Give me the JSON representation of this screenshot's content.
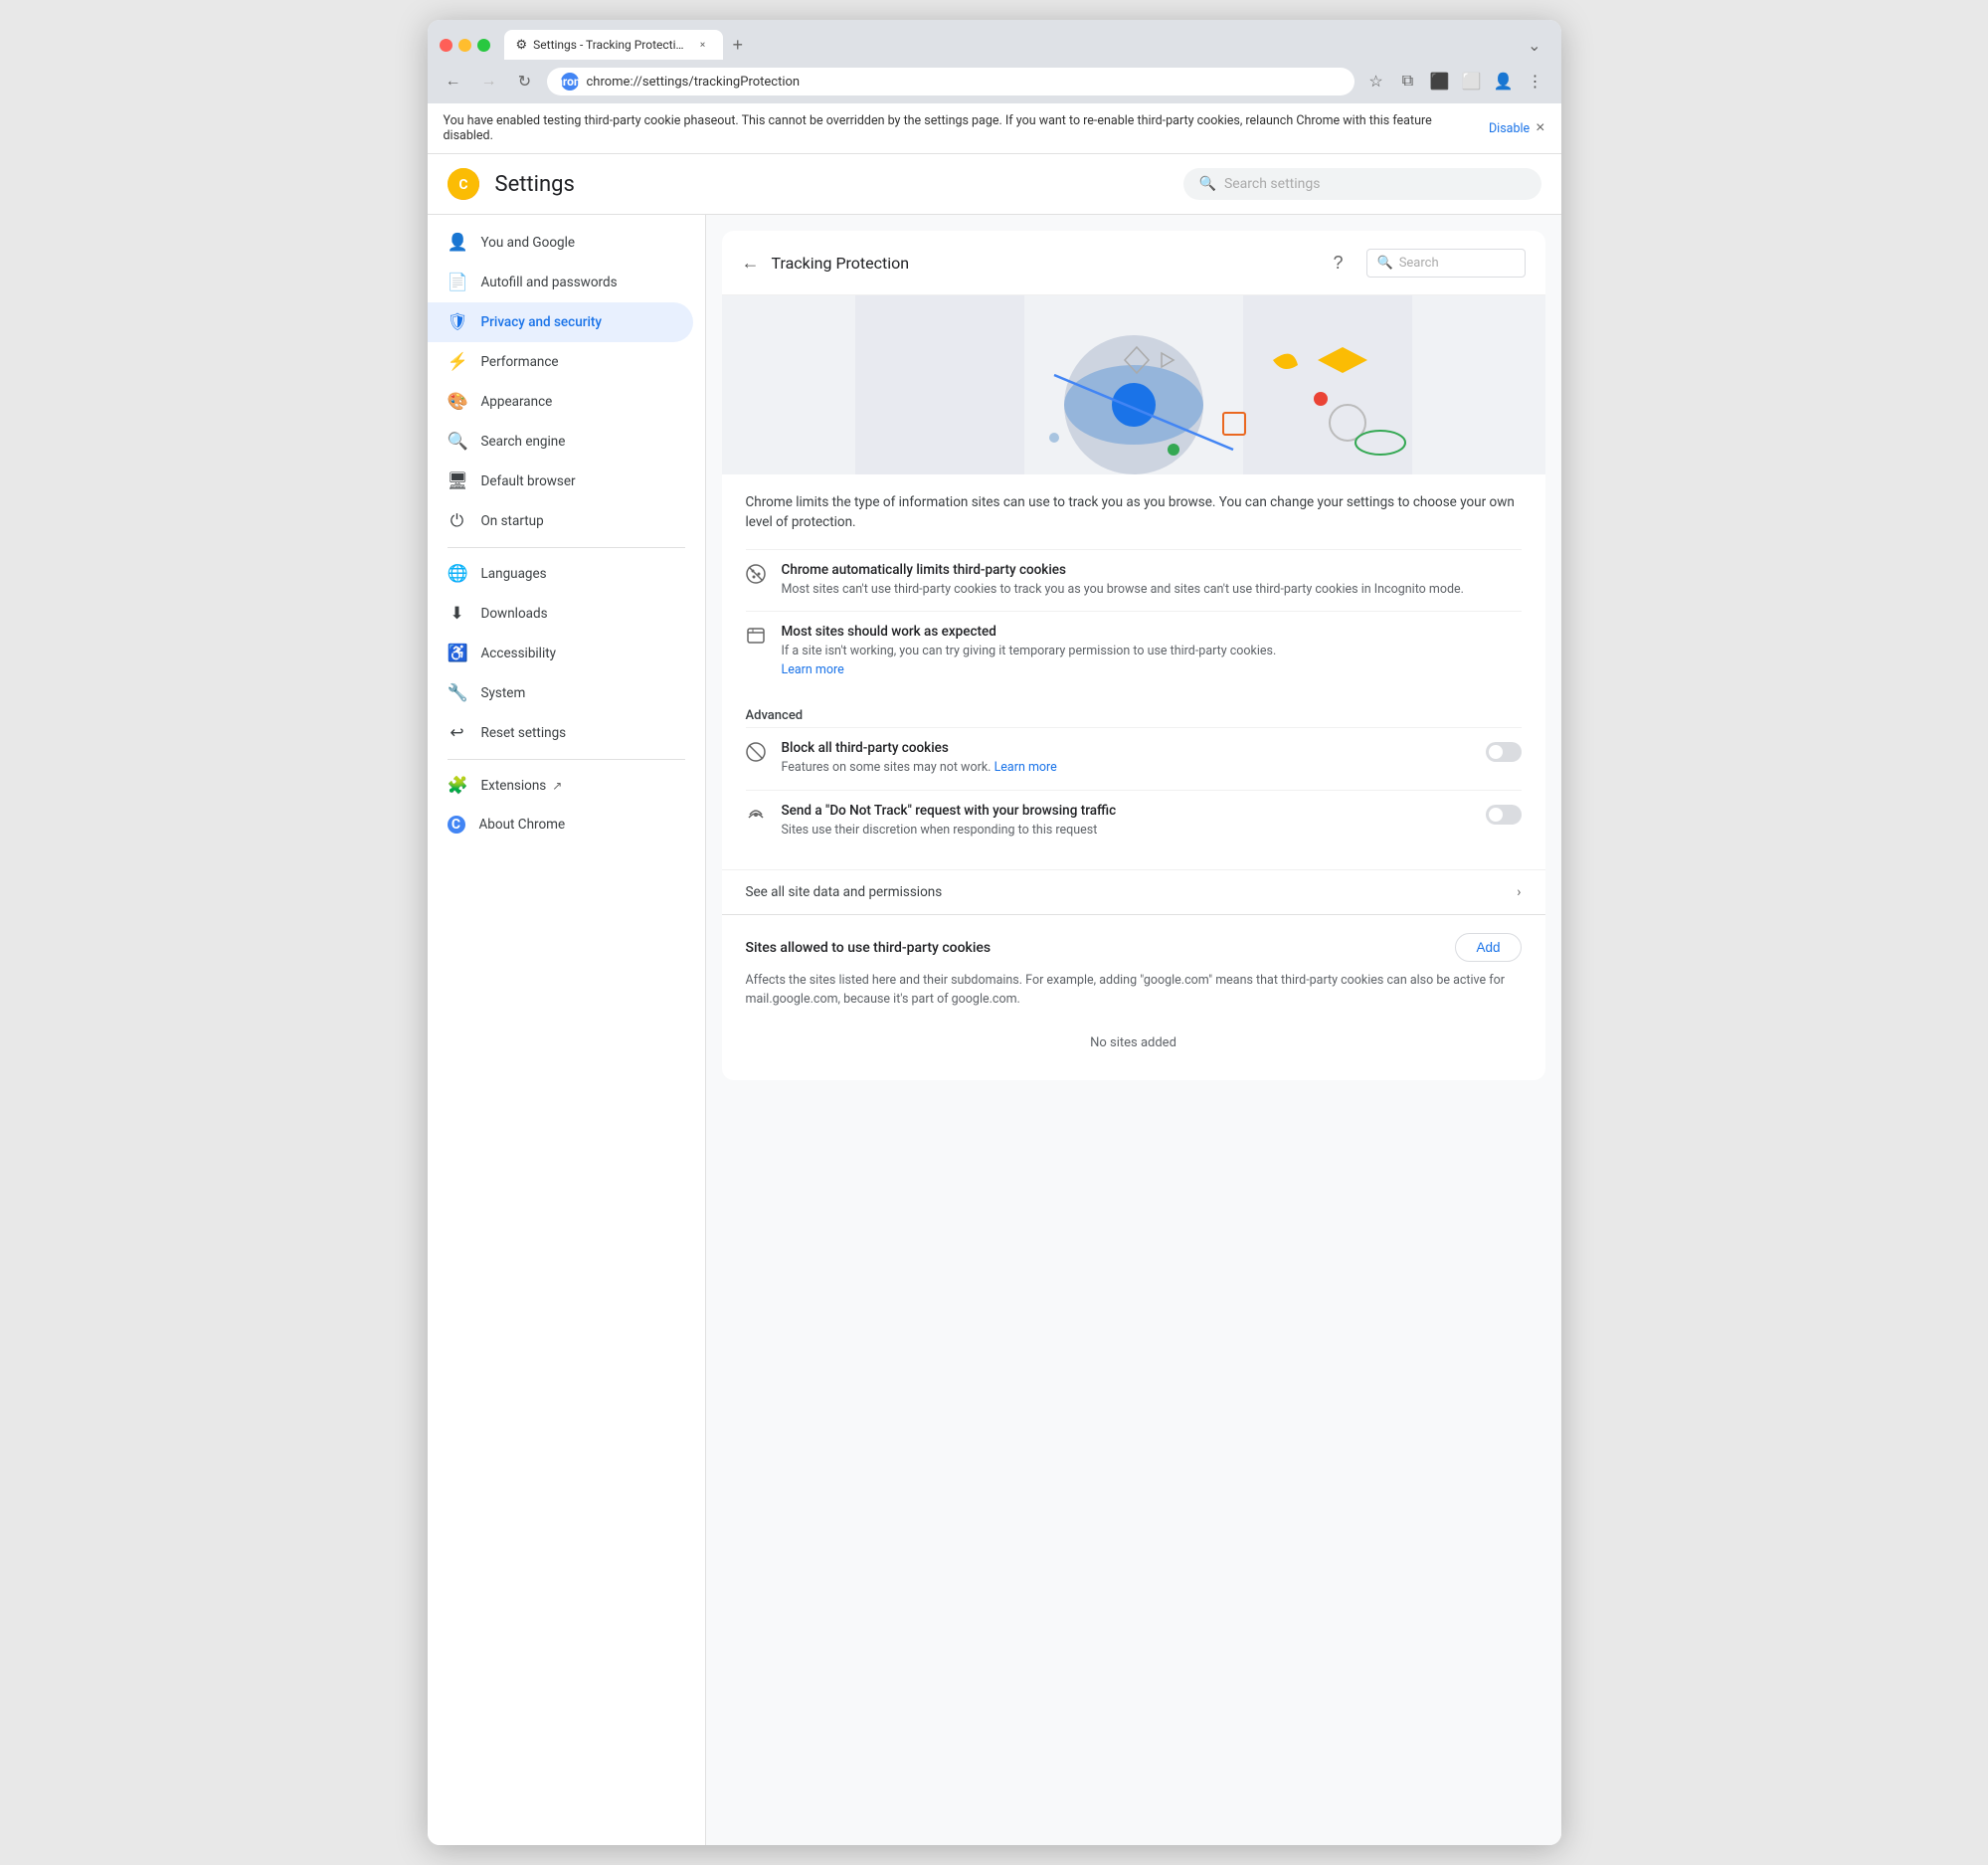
{
  "browser": {
    "tab_title": "Settings - Tracking Protectio…",
    "tab_close_label": "×",
    "new_tab_label": "+",
    "tab_overflow_label": "⌄",
    "nav_back_label": "←",
    "nav_forward_label": "→",
    "nav_refresh_label": "↻",
    "address_icon": "🔵",
    "address_url": "chrome://settings/trackingProtection",
    "address_brand": "Chrome",
    "bookmark_icon": "☆",
    "extensions_icon": "⧉",
    "cast_icon": "⬛",
    "split_icon": "⬜",
    "profile_icon": "👤",
    "menu_icon": "⋮"
  },
  "notification": {
    "text": "You have enabled testing third-party cookie phaseout. This cannot be overridden by the settings page. If you want to re-enable third-party cookies, relaunch Chrome with this feature disabled.",
    "link_label": "Disable",
    "close_label": "×"
  },
  "settings": {
    "logo_text": "C",
    "title": "Settings",
    "search_placeholder": "Search settings"
  },
  "sidebar": {
    "items": [
      {
        "id": "you-and-google",
        "icon": "👤",
        "label": "You and Google",
        "active": false
      },
      {
        "id": "autofill",
        "icon": "📄",
        "label": "Autofill and passwords",
        "active": false
      },
      {
        "id": "privacy",
        "icon": "🛡",
        "label": "Privacy and security",
        "active": true
      },
      {
        "id": "performance",
        "icon": "⚡",
        "label": "Performance",
        "active": false
      },
      {
        "id": "appearance",
        "icon": "🎨",
        "label": "Appearance",
        "active": false
      },
      {
        "id": "search-engine",
        "icon": "🔍",
        "label": "Search engine",
        "active": false
      },
      {
        "id": "default-browser",
        "icon": "🖥",
        "label": "Default browser",
        "active": false
      },
      {
        "id": "on-startup",
        "icon": "⏻",
        "label": "On startup",
        "active": false
      }
    ],
    "items2": [
      {
        "id": "languages",
        "icon": "🌐",
        "label": "Languages",
        "active": false
      },
      {
        "id": "downloads",
        "icon": "⬇",
        "label": "Downloads",
        "active": false
      },
      {
        "id": "accessibility",
        "icon": "♿",
        "label": "Accessibility",
        "active": false
      },
      {
        "id": "system",
        "icon": "🔧",
        "label": "System",
        "active": false
      },
      {
        "id": "reset",
        "icon": "↩",
        "label": "Reset settings",
        "active": false
      }
    ],
    "items3": [
      {
        "id": "extensions",
        "icon": "🧩",
        "label": "Extensions",
        "has_link": true
      },
      {
        "id": "about",
        "icon": "🔵",
        "label": "About Chrome",
        "has_link": false
      }
    ]
  },
  "panel": {
    "back_label": "←",
    "title": "Tracking Protection",
    "help_label": "?",
    "search_placeholder": "Search"
  },
  "hero": {
    "desc": "Chrome limits the type of information sites can use to track you as you browse. You can change your settings to choose your own level of protection."
  },
  "options": [
    {
      "id": "auto-limit",
      "title": "Chrome automatically limits third-party cookies",
      "desc": "Most sites can't use third-party cookies to track you as you browse and sites can't use third-party cookies in Incognito mode."
    },
    {
      "id": "sites-work",
      "title": "Most sites should work as expected",
      "desc": "If a site isn't working, you can try giving it temporary permission to use third-party cookies.",
      "link_label": "Learn more",
      "link_url": "#"
    }
  ],
  "advanced": {
    "heading": "Advanced",
    "items": [
      {
        "id": "block-all",
        "title": "Block all third-party cookies",
        "desc": "Features on some sites may not work.",
        "link_label": "Learn more",
        "link_url": "#",
        "toggle": false
      },
      {
        "id": "do-not-track",
        "title": "Send a \"Do Not Track\" request with your browsing traffic",
        "desc": "Sites use their discretion when responding to this request",
        "toggle": false
      }
    ]
  },
  "site_data": {
    "label": "See all site data and permissions",
    "chevron": "›"
  },
  "allowed_sites": {
    "heading": "Sites allowed to use third-party cookies",
    "desc": "Affects the sites listed here and their subdomains. For example, adding \"google.com\" means that third-party cookies can also be active for mail.google.com, because it's part of google.com.",
    "add_label": "Add",
    "empty_label": "No sites added"
  }
}
